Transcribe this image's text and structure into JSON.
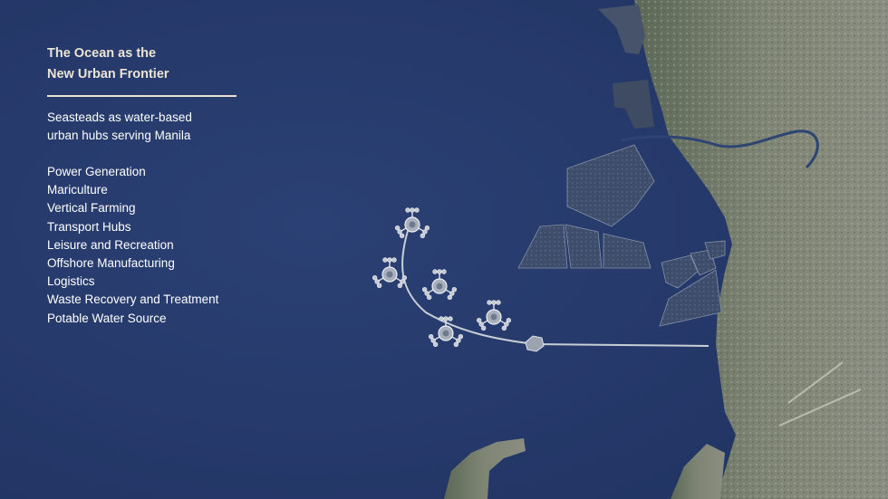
{
  "slide": {
    "title_lines": [
      "The Ocean as the",
      "New Urban Frontier"
    ],
    "subtitle_lines": [
      "Seasteads as water-based",
      "urban hubs serving Manila"
    ],
    "uses": [
      "Power Generation",
      "Mariculture",
      "Vertical Farming",
      "Transport Hubs",
      "Leisure and Recreation",
      "Offshore Manufacturing",
      "Logistics",
      "Waste Recovery and Treatment",
      "Potable Water Source"
    ]
  },
  "map": {
    "seastead_cluster_count": 5,
    "ocean_color": "#26396b",
    "land_color": "#6f7768",
    "reclaimed_color": "#3b4b6a",
    "causeway_color": "#c9ced6"
  }
}
